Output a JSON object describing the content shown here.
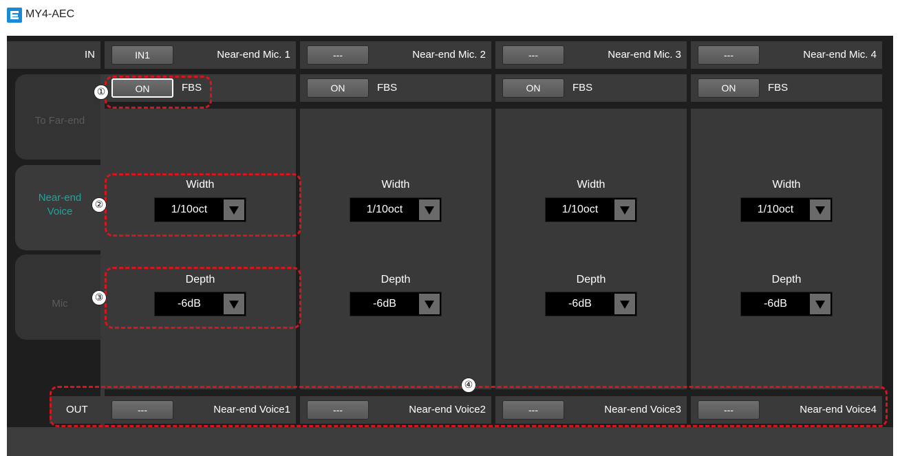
{
  "window": {
    "title": "MY4-AEC"
  },
  "rows": {
    "in_label": "IN",
    "out_label": "OUT"
  },
  "tabs": [
    {
      "label_line1": "To Far-end",
      "label_line2": ""
    },
    {
      "label_line1": "Near-end",
      "label_line2": "Voice"
    },
    {
      "label_line1": "Mic",
      "label_line2": ""
    }
  ],
  "channels": [
    {
      "in_button": "IN1",
      "in_name": "Near-end Mic. 1",
      "on_label": "ON",
      "fbs_label": "FBS",
      "width_label": "Width",
      "width_value": "1/10oct",
      "depth_label": "Depth",
      "depth_value": "-6dB",
      "out_button": "---",
      "out_name": "Near-end Voice1"
    },
    {
      "in_button": "---",
      "in_name": "Near-end Mic. 2",
      "on_label": "ON",
      "fbs_label": "FBS",
      "width_label": "Width",
      "width_value": "1/10oct",
      "depth_label": "Depth",
      "depth_value": "-6dB",
      "out_button": "---",
      "out_name": "Near-end Voice2"
    },
    {
      "in_button": "---",
      "in_name": "Near-end Mic. 3",
      "on_label": "ON",
      "fbs_label": "FBS",
      "width_label": "Width",
      "width_value": "1/10oct",
      "depth_label": "Depth",
      "depth_value": "-6dB",
      "out_button": "---",
      "out_name": "Near-end Voice3"
    },
    {
      "in_button": "---",
      "in_name": "Near-end Mic. 4",
      "on_label": "ON",
      "fbs_label": "FBS",
      "width_label": "Width",
      "width_value": "1/10oct",
      "depth_label": "Depth",
      "depth_value": "-6dB",
      "out_button": "---",
      "out_name": "Near-end Voice4"
    }
  ],
  "callouts": [
    "①",
    "②",
    "③",
    "④"
  ],
  "colors": {
    "highlight": "#d8141c",
    "active_tab": "#1fa59c",
    "background": "#1e1e1e",
    "panel": "#393939"
  }
}
